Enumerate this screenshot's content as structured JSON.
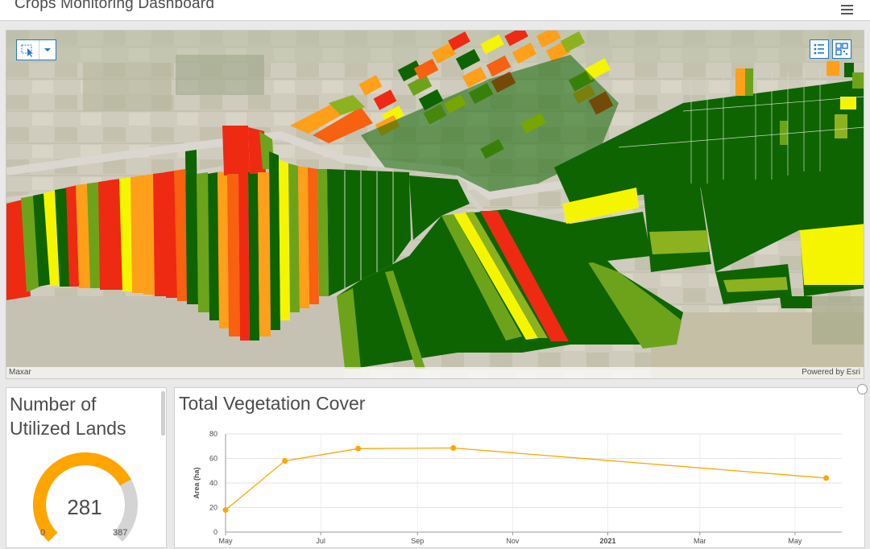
{
  "header": {
    "title": "Crops Monitoring Dashboard",
    "menu_icon": "hamburger-menu-icon"
  },
  "map": {
    "attribution_left": "Maxar",
    "attribution_right": "Powered by Esri",
    "tools": {
      "select_icon": "select-tool-icon",
      "dropdown_icon": "chevron-down-icon",
      "legend_icon": "legend-icon",
      "layers_icon": "qr-layers-icon"
    },
    "field_colors": [
      "#0e6400",
      "#1c6e06",
      "#6da31a",
      "#8db21f",
      "#f5f500",
      "#ff9f1a",
      "#f7610f",
      "#ee2a12"
    ]
  },
  "gauge": {
    "title": "Number of Utilized Lands",
    "value": "281",
    "min": "0",
    "max": "387",
    "fill_fraction": 0.726,
    "fill_color": "#ffa500",
    "track_color": "#d4d4d4"
  },
  "chart_data": {
    "type": "line",
    "title": "Total Vegetation Cover",
    "xlabel": "",
    "ylabel": "Area (ha)",
    "ylim": [
      0,
      80
    ],
    "y_ticks": [
      "0",
      "20",
      "40",
      "60",
      "80"
    ],
    "x_ticks": [
      "May",
      "Jul",
      "Sep",
      "Nov",
      "2021",
      "Mar",
      "May"
    ],
    "x_dates": [
      "2020-05-01",
      "2020-06-08",
      "2020-07-25",
      "2020-09-24",
      "2021-05-21"
    ],
    "values": [
      18,
      58,
      68,
      68.5,
      44
    ],
    "line_color": "#ffa500",
    "grid": true
  }
}
